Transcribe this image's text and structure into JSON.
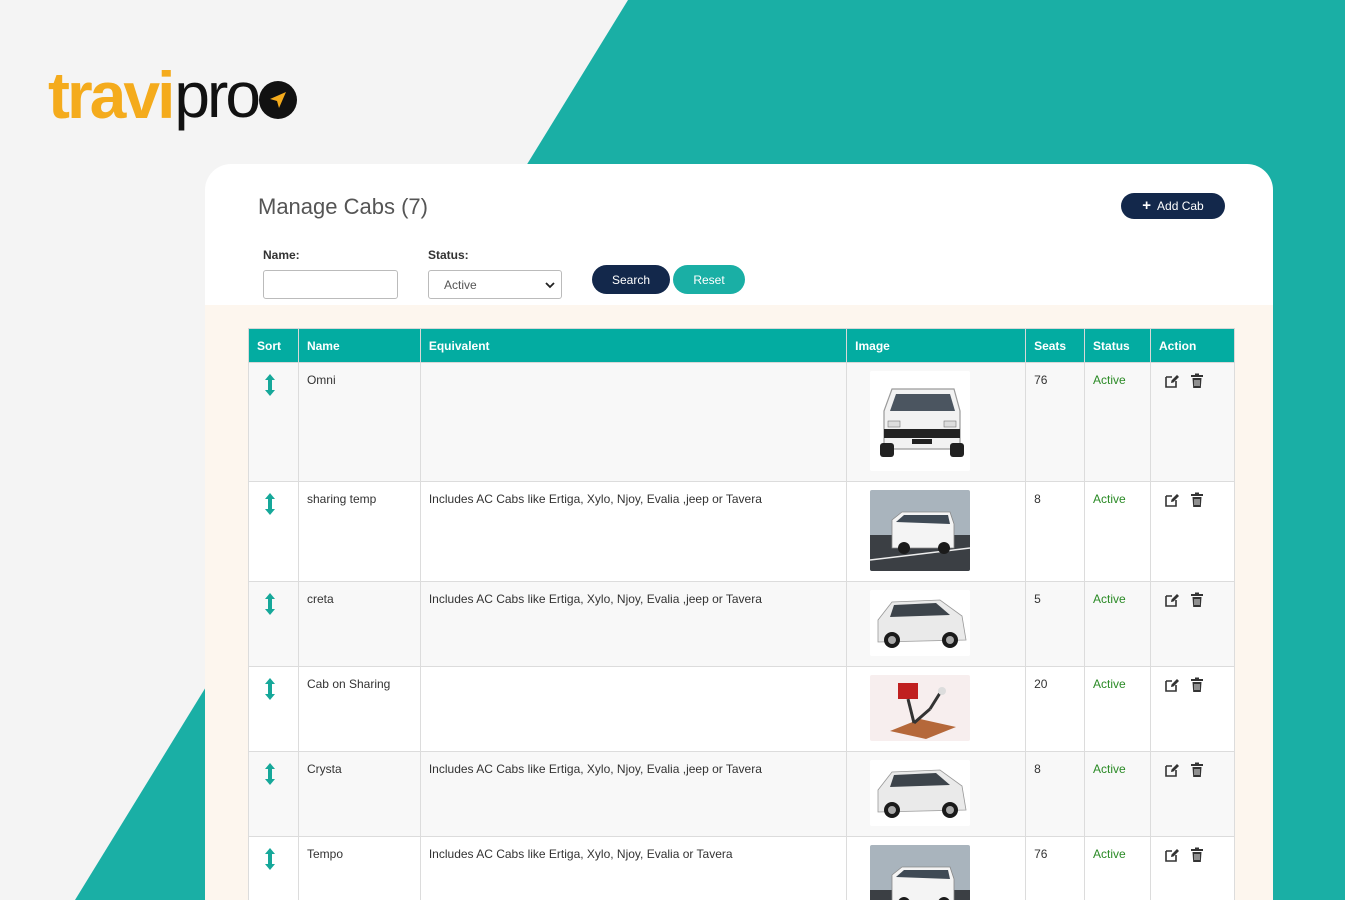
{
  "brand": {
    "logo_part1": "travi",
    "logo_part2": "pro"
  },
  "page": {
    "title": "Manage Cabs (7)"
  },
  "toolbar": {
    "add_label": "Add Cab"
  },
  "filters": {
    "name_label": "Name:",
    "name_value": "",
    "status_label": "Status:",
    "status_value": "Active",
    "search_label": "Search",
    "reset_label": "Reset"
  },
  "table": {
    "columns": [
      "Sort",
      "Name",
      "Equivalent",
      "Image",
      "Seats",
      "Status",
      "Action"
    ],
    "rows": [
      {
        "name": "Omni",
        "equivalent": "",
        "seats": "76",
        "status": "Active",
        "image": "white-van-front"
      },
      {
        "name": "sharing temp",
        "equivalent": "Includes AC Cabs like Ertiga, Xylo, Njoy, Evalia ,jeep or Tavera",
        "seats": "8",
        "status": "Active",
        "image": "white-tempo-road"
      },
      {
        "name": "creta",
        "equivalent": "Includes AC Cabs like Ertiga, Xylo, Njoy, Evalia ,jeep or Tavera",
        "seats": "5",
        "status": "Active",
        "image": "white-suv"
      },
      {
        "name": "Cab on Sharing",
        "equivalent": "",
        "seats": "20",
        "status": "Active",
        "image": "red-machine"
      },
      {
        "name": "Crysta",
        "equivalent": "Includes AC Cabs like Ertiga, Xylo, Njoy, Evalia ,jeep or Tavera",
        "seats": "8",
        "status": "Active",
        "image": "white-suv"
      },
      {
        "name": "Tempo",
        "equivalent": "Includes AC Cabs like Ertiga, Xylo, Njoy, Evalia or Tavera",
        "seats": "76",
        "status": "Active",
        "image": "white-tempo-road"
      }
    ]
  },
  "colors": {
    "teal": "#1aafa5",
    "navy": "#13284b",
    "logo_orange": "#f4ab1c",
    "status_green": "#2a8a25"
  }
}
